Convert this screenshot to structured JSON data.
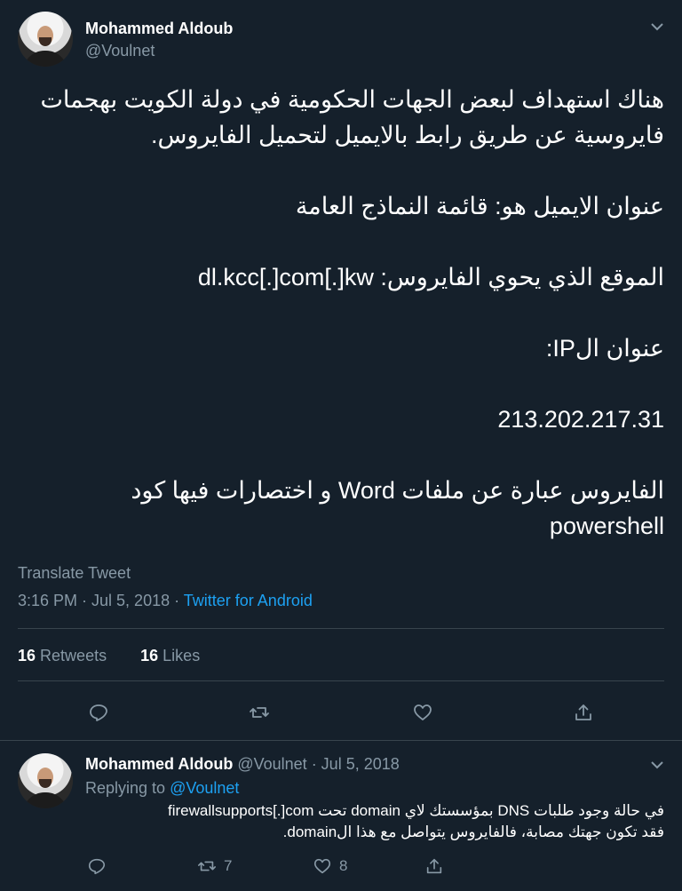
{
  "main_tweet": {
    "author_name": "Mohammed Aldoub",
    "author_handle": "@Voulnet",
    "text_lines": [
      "هناك استهداف لبعض الجهات الحكومية في دولة الكويت بهجمات",
      "فايروسية عن طريق رابط بالايميل لتحميل الفايروس.",
      "",
      "عنوان الايميل هو: قائمة النماذج العامة",
      "",
      "الموقع الذي يحوي الفايروس: dl.kcc[.]com[.]kw",
      "",
      "عنوان الIP:",
      "",
      "213.202.217.31",
      "",
      "الفايروس عبارة عن ملفات Word و اختصارات فيها كود",
      "powershell"
    ],
    "translate_label": "Translate Tweet",
    "timestamp": "3:16 PM · Jul 5, 2018 · ",
    "source": "Twitter for Android",
    "retweets_count": "16",
    "retweets_label": "Retweets",
    "likes_count": "16",
    "likes_label": "Likes"
  },
  "reply_tweet": {
    "author_name": "Mohammed Aldoub",
    "author_handle": "@Voulnet",
    "date": "· Jul 5, 2018",
    "replying_to_label": "Replying to ",
    "replying_to_handle": "@Voulnet",
    "text_lines": [
      "في حالة وجود طلبات DNS بمؤسستك لاي domain تحت firewallsupports[.]com",
      "فقد تكون جهتك مصابة، فالفايروس يتواصل مع هذا الdomain."
    ],
    "retweet_count": "7",
    "like_count": "8"
  },
  "icons": {
    "reply": "reply-icon",
    "retweet": "retweet-icon",
    "like": "heart-icon",
    "share": "share-icon",
    "more": "chevron-down-icon"
  },
  "colors": {
    "background": "#15202b",
    "link": "#1da1f2",
    "muted": "#8899a6",
    "divider": "#38444d"
  }
}
